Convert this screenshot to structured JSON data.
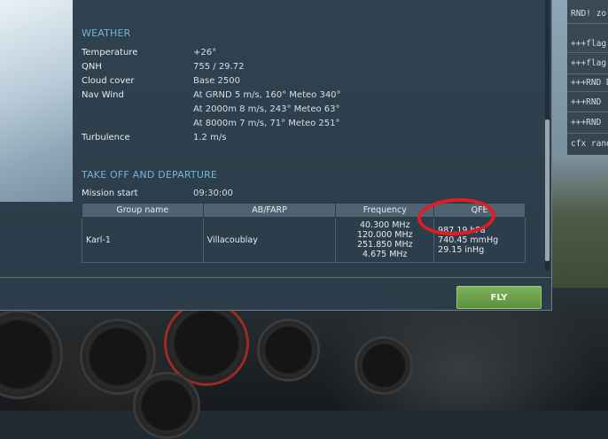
{
  "weather": {
    "title": "WEATHER",
    "rows": [
      {
        "label": "Temperature",
        "value": "+26°"
      },
      {
        "label": "QNH",
        "value": "755 / 29.72"
      },
      {
        "label": "Cloud cover",
        "value": "Base 2500"
      },
      {
        "label": "Nav Wind",
        "value": "At GRND 5 m/s, 160° Meteo 340°"
      },
      {
        "label": "",
        "value": "At 2000m 8 m/s, 243° Meteo 63°"
      },
      {
        "label": "",
        "value": "At 8000m 7 m/s, 71° Meteo 251°"
      },
      {
        "label": "Turbulence",
        "value": "1.2 m/s"
      }
    ]
  },
  "takeoff": {
    "title": "TAKE OFF AND DEPARTURE",
    "mission_start_label": "Mission start",
    "mission_start_value": "09:30:00",
    "table": {
      "headers": [
        "Group name",
        "AB/FARP",
        "Frequency",
        "QFE"
      ],
      "rows": [
        {
          "group": "Karl-1",
          "airbase": "Villacoublay",
          "frequencies": [
            "40.300 MHz",
            "120.000 MHz",
            "251.850 MHz",
            "4.675 MHz"
          ],
          "qfe": [
            "987.19 hPa",
            "740.45 mmHg",
            "29.15 inHg"
          ]
        }
      ]
    }
  },
  "footer": {
    "fly_label": "FLY"
  },
  "log": {
    "lines": [
      "RND! zo",
      "+++flag Deauvil",
      "+++flag",
      "+++RND Drucat, S",
      "+++RND",
      "+++RND",
      "cfx rand"
    ]
  },
  "colors": {
    "section_title": "#72b6db",
    "fly_button": "#6aa149",
    "highlight_ring": "#e01c24"
  }
}
